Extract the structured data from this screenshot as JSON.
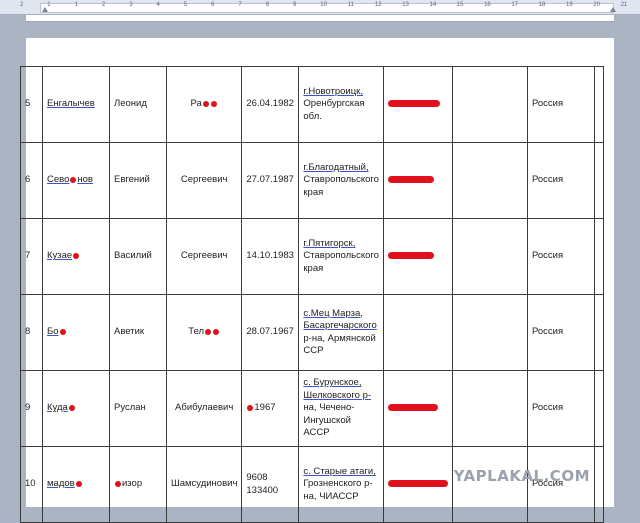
{
  "ruler": {
    "numbers": [
      "2",
      "1",
      "1",
      "2",
      "3",
      "4",
      "5",
      "6",
      "7",
      "8",
      "9",
      "10",
      "11",
      "12",
      "13",
      "14",
      "15",
      "16",
      "17",
      "18",
      "19",
      "20",
      "21"
    ]
  },
  "table": {
    "rows": [
      {
        "num": "5",
        "surname": "Енгалычев",
        "name": "Леонид",
        "patronymic": "Ра",
        "date": "26.04.1982",
        "place": [
          "г.Новотроицк,",
          "Оренбургская",
          "обл."
        ],
        "passport": "",
        "country": "Россия"
      },
      {
        "num": "6",
        "surname": "Сево",
        "surname_tail": "нов",
        "name": "Евгений",
        "patronymic": "Сергеевич",
        "date": "27.07.1987",
        "place": [
          "г.Благодатный,",
          "Ставропольского",
          "края"
        ],
        "passport": "",
        "country": "Россия"
      },
      {
        "num": "7",
        "surname": "Кузае",
        "name": "Василий",
        "patronymic": "Сергеевич",
        "date": "14.10.1983",
        "place": [
          "г.Пятигорск,",
          "Ставропольского",
          "края"
        ],
        "passport": "",
        "country": "Россия"
      },
      {
        "num": "8",
        "surname": "Бо",
        "name": "Аветик",
        "patronymic": "Тел",
        "date": "28.07.1967",
        "place": [
          "с.Мец Марза,",
          "Басаргечарского",
          "р-на, Армянской",
          "ССР"
        ],
        "passport": "",
        "country": "Россия"
      },
      {
        "num": "9",
        "surname": "Куда",
        "name": "Руслан",
        "patronymic": "Абибулаевич",
        "date": "1967",
        "place": [
          "с. Бурунское,",
          "Шелковского р-",
          "на, Чечено-",
          "Ингушской",
          "АССР"
        ],
        "passport": "",
        "country": "Россия"
      },
      {
        "num": "10",
        "surname": "мадов",
        "name": "изор",
        "patronymic": "Шамсудинович",
        "date": "9608 133400",
        "place": [
          "с. Старые атаги,",
          "Грозненского р-",
          "на, ЧИАССР"
        ],
        "passport": "",
        "country": "Россия"
      }
    ]
  },
  "watermark": "YAPLAKAL.COM"
}
